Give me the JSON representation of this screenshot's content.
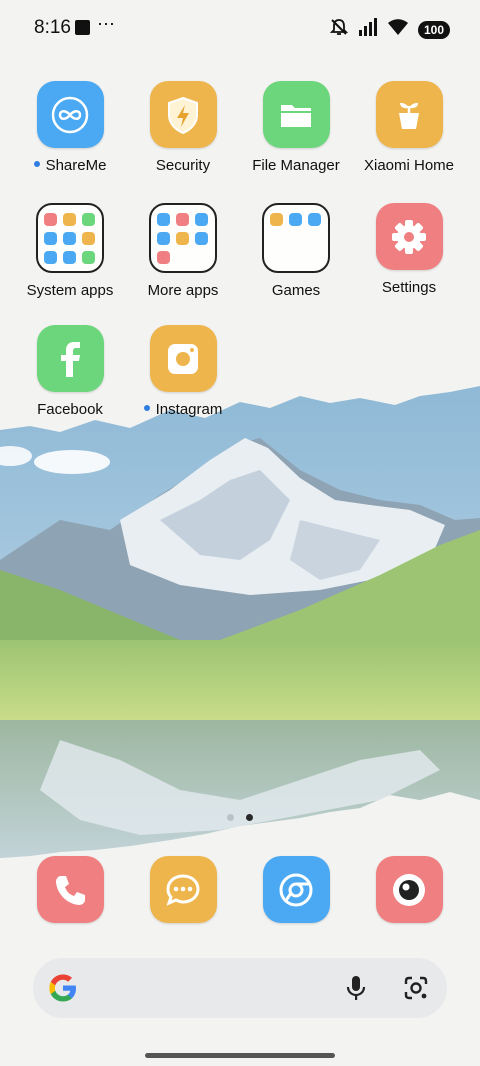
{
  "status_bar": {
    "time": "8:16",
    "dots": "⋯",
    "battery": "100"
  },
  "apps": {
    "shareme": "ShareMe",
    "security": "Security",
    "file_manager": "File Manager",
    "xiaomi_home": "Xiaomi Home",
    "system_apps": "System apps",
    "more_apps": "More apps",
    "games": "Games",
    "settings": "Settings",
    "facebook": "Facebook",
    "instagram": "Instagram"
  },
  "colors": {
    "blue_icon": "#4aa9f2",
    "orange_icon": "#efb54d",
    "green_icon": "#6bd67c",
    "red_icon": "#ef7f80",
    "new_dot": "#2f7de1"
  },
  "page_indicator": {
    "pages": 2,
    "current": 2
  },
  "icons": {
    "shareme": "infinity-loop-icon",
    "security": "shield-bolt-icon",
    "file_manager": "folder-icon",
    "xiaomi_home": "plant-pot-icon",
    "settings": "gear-icon",
    "facebook": "facebook-f-icon",
    "instagram": "camera-icon",
    "dock": [
      "phone-icon",
      "message-icon",
      "browser-icon",
      "camera-lens-icon"
    ],
    "search": [
      "google-g-icon",
      "microphone-icon",
      "lens-icon"
    ]
  }
}
